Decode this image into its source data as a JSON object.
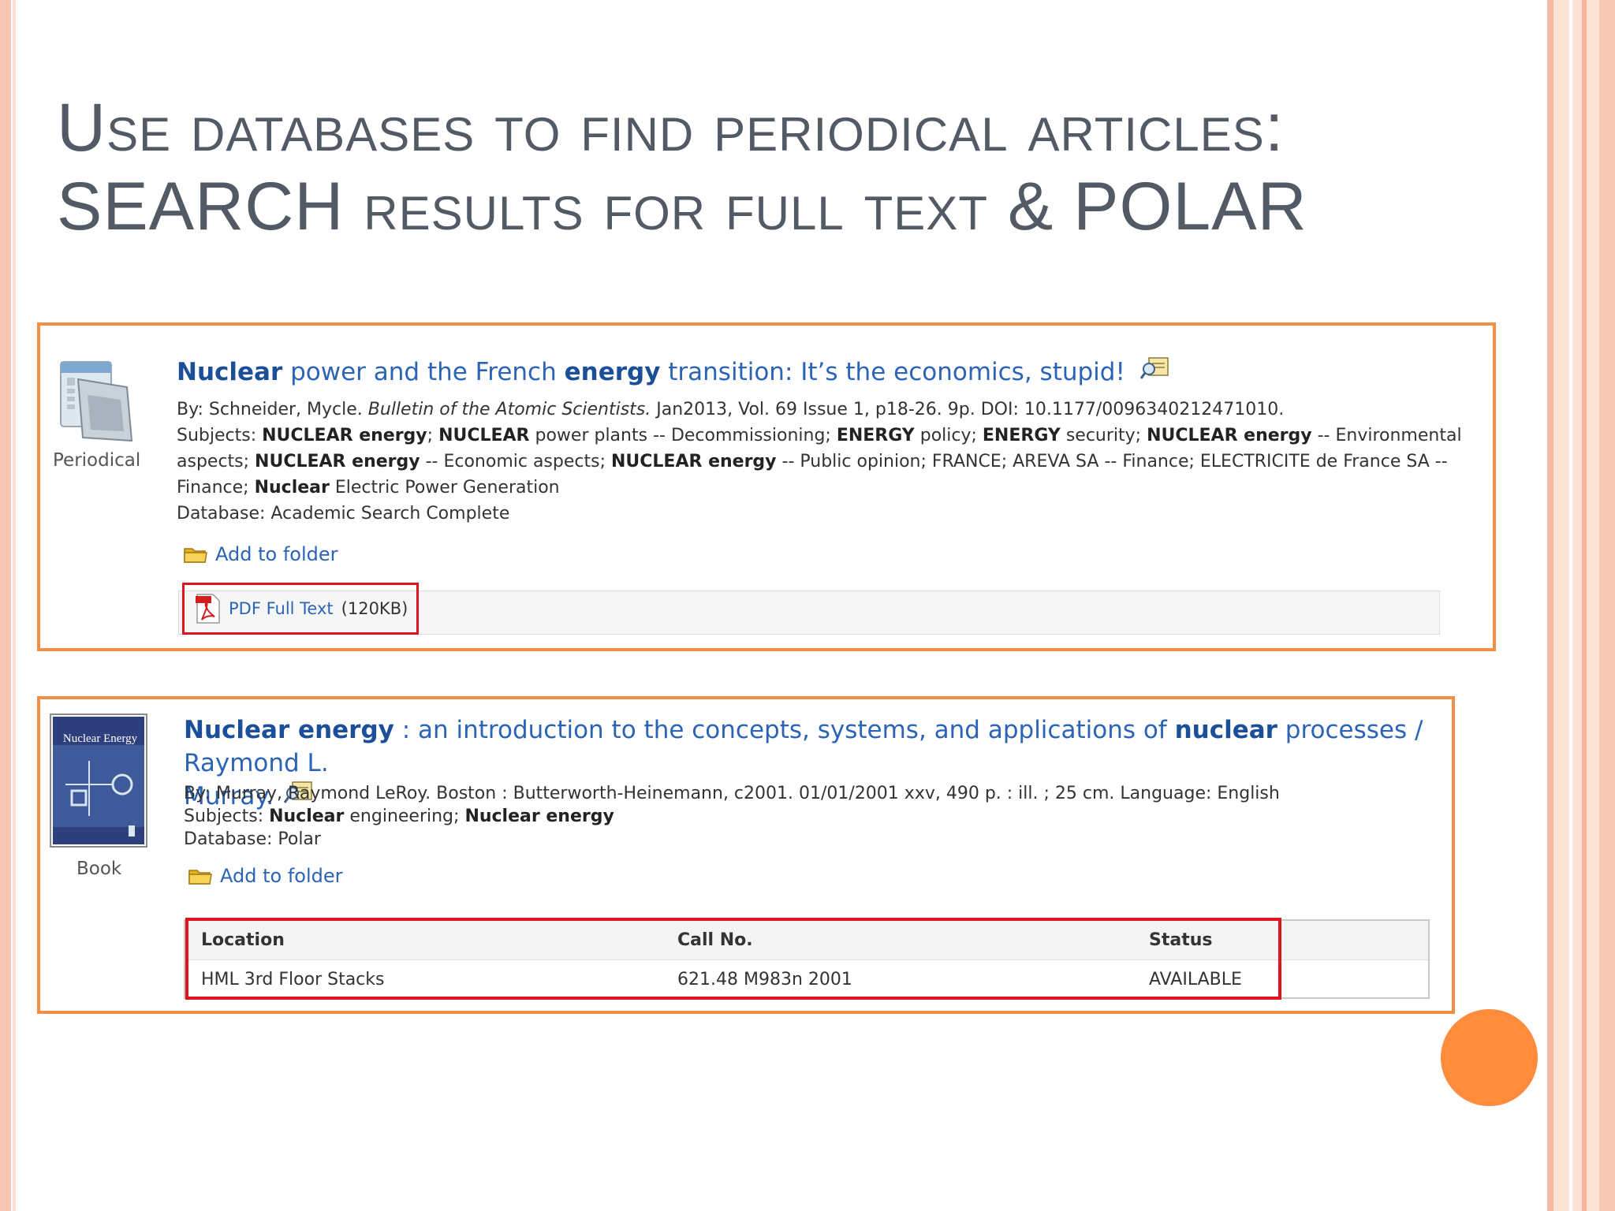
{
  "slide": {
    "title_line1": "Use databases to find periodical articles:",
    "title_line2": "SEARCH results for full text & POLAR"
  },
  "result1": {
    "type_label": "Periodical",
    "title_parts": [
      "Nuclear",
      " power and the French ",
      "energy",
      " transition: It’s the economics, stupid!"
    ],
    "byline_pre": "By: Schneider, Mycle. ",
    "byline_journal": "Bulletin of the Atomic Scientists.",
    "byline_post": " Jan2013, Vol. 69 Issue 1, p18-26. 9p. DOI: 10.1177/0096340212471010.",
    "subjects_line1": [
      {
        "t": "Subjects: ",
        "b": false
      },
      {
        "t": "NUCLEAR energy",
        "b": true
      },
      {
        "t": "; ",
        "b": false
      },
      {
        "t": "NUCLEAR",
        "b": true
      },
      {
        "t": " power plants -- Decommissioning; ",
        "b": false
      },
      {
        "t": "ENERGY",
        "b": true
      },
      {
        "t": " policy; ",
        "b": false
      },
      {
        "t": "ENERGY",
        "b": true
      },
      {
        "t": " security; ",
        "b": false
      },
      {
        "t": "NUCLEAR energy",
        "b": true
      },
      {
        "t": " -- Environmental",
        "b": false
      }
    ],
    "subjects_line2": [
      {
        "t": "aspects; ",
        "b": false
      },
      {
        "t": "NUCLEAR energy",
        "b": true
      },
      {
        "t": " -- Economic aspects; ",
        "b": false
      },
      {
        "t": "NUCLEAR energy",
        "b": true
      },
      {
        "t": " -- Public opinion; FRANCE; AREVA SA -- Finance; ELECTRICITE de France SA --",
        "b": false
      }
    ],
    "subjects_line3": [
      {
        "t": "Finance; ",
        "b": false
      },
      {
        "t": "Nuclear",
        "b": true
      },
      {
        "t": " Electric Power Generation",
        "b": false
      }
    ],
    "database": "Database: Academic Search Complete",
    "add_to_folder": "Add to folder",
    "pdf_label": "PDF Full Text",
    "pdf_size": "(120KB)"
  },
  "result2": {
    "type_label": "Book",
    "cover_title": "Nuclear Energy",
    "title_line1_parts": [
      "Nuclear energy",
      " : an introduction to the concepts, systems, and applications of ",
      "nuclear",
      " processes / Raymond L."
    ],
    "title_line2": "Murray.",
    "byline": "By: Murray, Raymond LeRoy. Boston : Butterworth-Heinemann, c2001. 01/01/2001 xxv, 490 p. : ill. ; 25 cm. Language: English",
    "subjects": [
      {
        "t": "Subjects: ",
        "b": false
      },
      {
        "t": "Nuclear",
        "b": true
      },
      {
        "t": " engineering; ",
        "b": false
      },
      {
        "t": "Nuclear energy",
        "b": true
      }
    ],
    "database": "Database: Polar",
    "add_to_folder": "Add to folder",
    "holdings": {
      "headers": [
        "Location",
        "Call No.",
        "Status"
      ],
      "row": [
        "HML 3rd Floor Stacks",
        "621.48 M983n 2001",
        "AVAILABLE"
      ]
    }
  }
}
